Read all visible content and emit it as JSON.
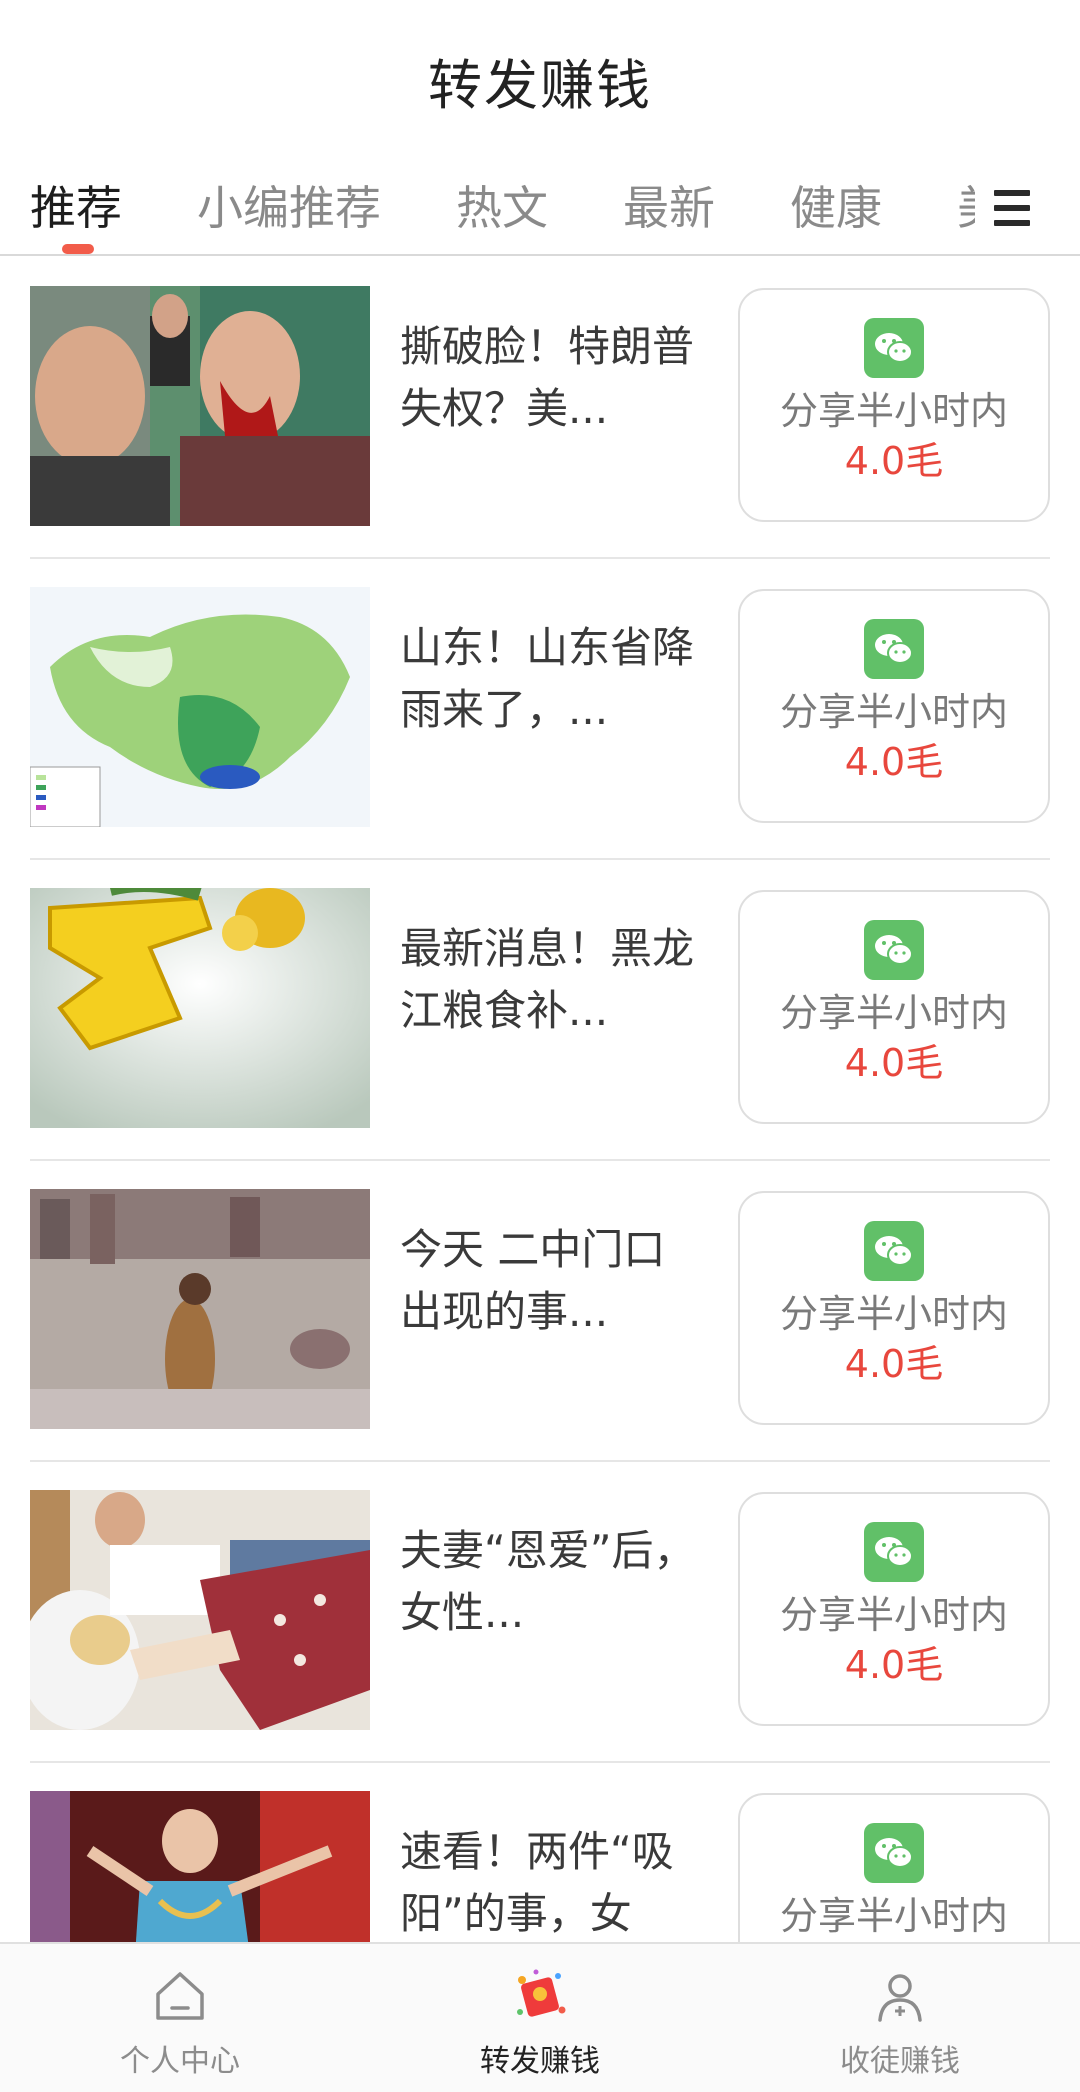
{
  "header": {
    "title": "转发赚钱"
  },
  "tabs": {
    "items": [
      {
        "label": "推荐",
        "active": true
      },
      {
        "label": "小编推荐"
      },
      {
        "label": "热文"
      },
      {
        "label": "最新"
      },
      {
        "label": "健康"
      },
      {
        "label": "美"
      }
    ],
    "menu_icon": "hamburger-menu-icon"
  },
  "articles": [
    {
      "title": "撕破脸！特朗普失权？美...",
      "share_label": "分享半小时内",
      "reward": "4.0毛"
    },
    {
      "title": "山东！山东省降雨来了，...",
      "share_label": "分享半小时内",
      "reward": "4.0毛"
    },
    {
      "title": "最新消息！黑龙江粮食补...",
      "share_label": "分享半小时内",
      "reward": "4.0毛"
    },
    {
      "title": "今天 二中门口 出现的事...",
      "share_label": "分享半小时内",
      "reward": "4.0毛"
    },
    {
      "title": "夫妻“恩爱”后，女性...",
      "share_label": "分享半小时内",
      "reward": "4.0毛"
    },
    {
      "title": "速看！两件“吸阳”的事，女",
      "share_label": "分享半小时内",
      "reward": ""
    }
  ],
  "share_icon": "wechat-icon",
  "bottom_nav": [
    {
      "label": "个人中心",
      "icon": "home-icon"
    },
    {
      "label": "转发赚钱",
      "icon": "red-packet-icon",
      "active": true
    },
    {
      "label": "收徒赚钱",
      "icon": "user-add-icon"
    }
  ],
  "colors": {
    "accent": "#f25c4a",
    "reward": "#e8473d",
    "wechat": "#61c068"
  }
}
